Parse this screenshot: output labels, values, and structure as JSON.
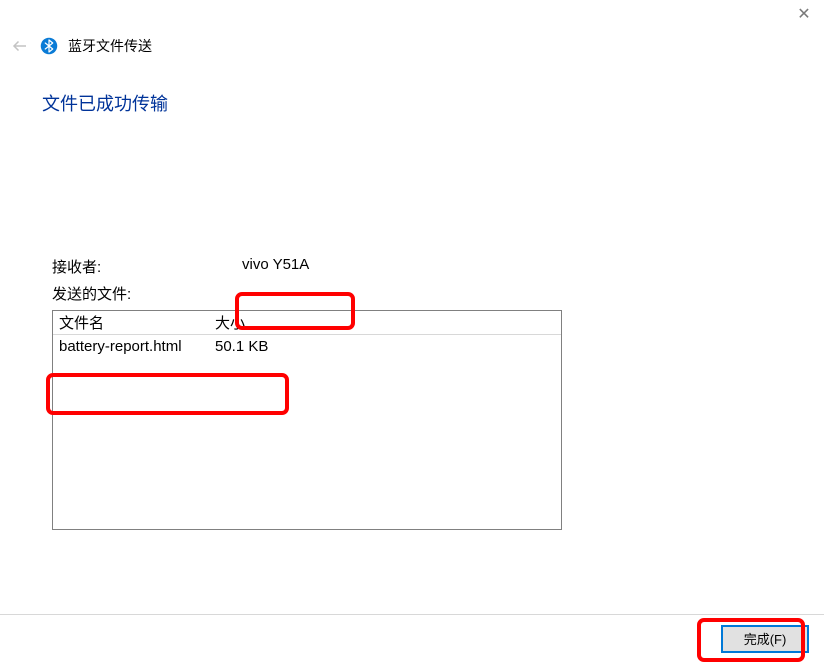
{
  "titlebar": {
    "close_symbol": "✕"
  },
  "header": {
    "wizard_title": "蓝牙文件传送"
  },
  "main": {
    "heading": "文件已成功传输",
    "recipient_label": "接收者:",
    "recipient_value": "vivo Y51A",
    "sent_files_label": "发送的文件:",
    "table": {
      "col_name": "文件名",
      "col_size": "大小",
      "rows": [
        {
          "name": "battery-report.html",
          "size": "50.1 KB"
        }
      ]
    }
  },
  "footer": {
    "finish_label": "完成(F)"
  }
}
